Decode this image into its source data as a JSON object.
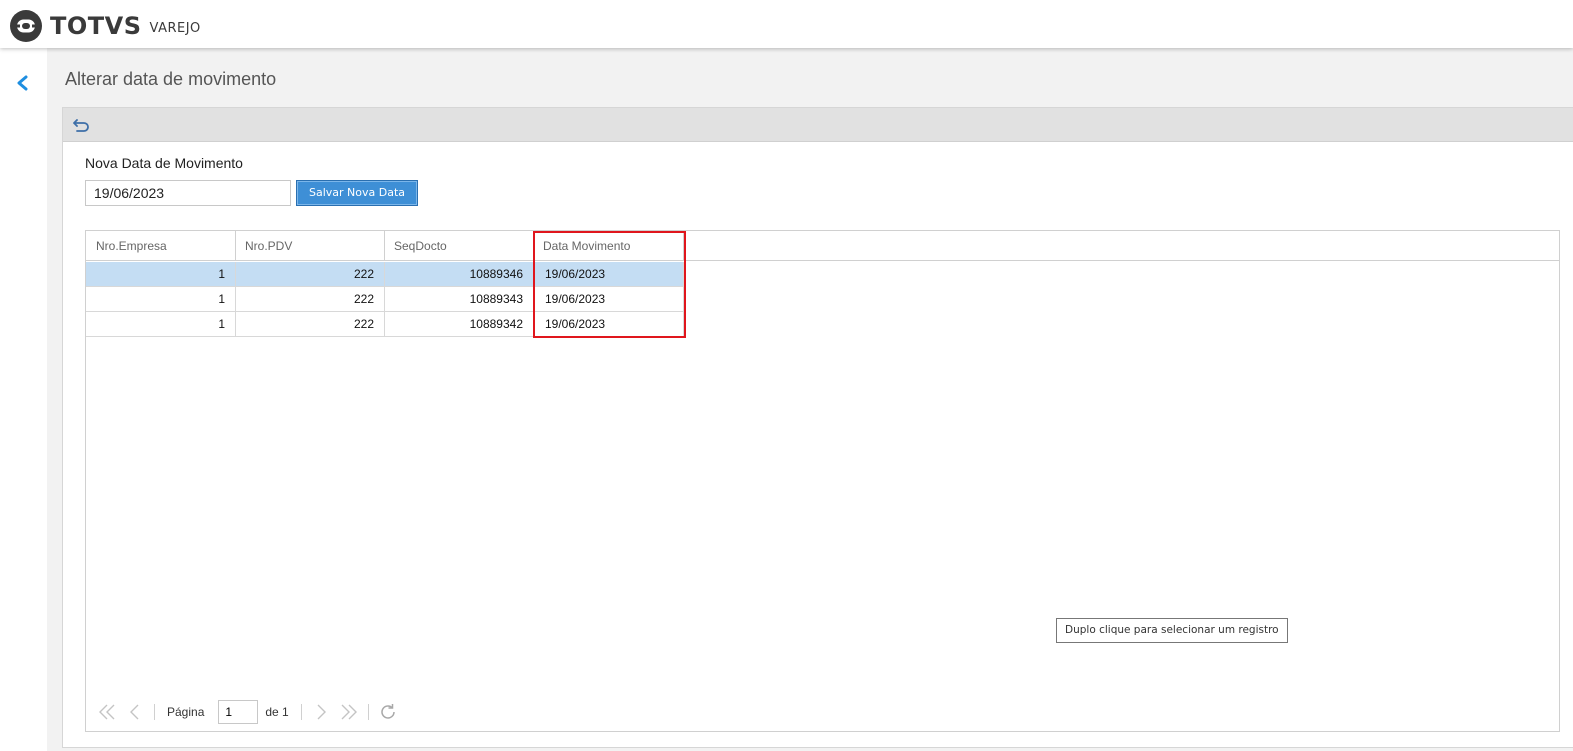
{
  "app": {
    "logo_text": "TOTVS",
    "logo_sub": "VAREJO"
  },
  "page": {
    "title": "Alterar data de movimento"
  },
  "form": {
    "label": "Nova Data de Movimento",
    "date_value": "19/06/2023",
    "save_label": "Salvar Nova Data"
  },
  "grid": {
    "columns": [
      "Nro.Empresa",
      "Nro.PDV",
      "SeqDocto",
      "Data Movimento"
    ],
    "rows": [
      {
        "empresa": "1",
        "pdv": "222",
        "seq": "10889346",
        "data": "19/06/2023",
        "selected": true
      },
      {
        "empresa": "1",
        "pdv": "222",
        "seq": "10889343",
        "data": "19/06/2023",
        "selected": false
      },
      {
        "empresa": "1",
        "pdv": "222",
        "seq": "10889342",
        "data": "19/06/2023",
        "selected": false
      }
    ]
  },
  "tooltip": {
    "text": "Duplo clique para selecionar um registro"
  },
  "pager": {
    "page_label": "Página",
    "page_value": "1",
    "of_label": "de 1"
  },
  "icons": {
    "back": "chevron-left-icon",
    "undo": "undo-icon",
    "first": "first-page-icon",
    "prev": "prev-page-icon",
    "next": "next-page-icon",
    "last": "last-page-icon",
    "refresh": "refresh-icon"
  },
  "colors": {
    "accent": "#3e8fd6",
    "selected_row": "#c4ddf3",
    "highlight": "#e0161d"
  }
}
